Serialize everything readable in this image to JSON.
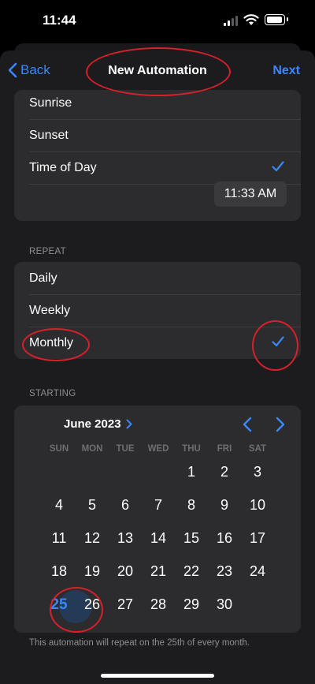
{
  "status_bar": {
    "time": "11:44"
  },
  "nav": {
    "back_label": "Back",
    "title": "New Automation",
    "next_label": "Next"
  },
  "time_options": {
    "items": [
      {
        "label": "Sunrise",
        "selected": false
      },
      {
        "label": "Sunset",
        "selected": false
      },
      {
        "label": "Time of Day",
        "selected": true
      }
    ],
    "time_value": "11:33 AM"
  },
  "repeat": {
    "header": "REPEAT",
    "items": [
      {
        "label": "Daily",
        "selected": false
      },
      {
        "label": "Weekly",
        "selected": false
      },
      {
        "label": "Monthly",
        "selected": true
      }
    ]
  },
  "starting": {
    "header": "STARTING",
    "month_label": "June 2023",
    "weekdays": [
      "SUN",
      "MON",
      "TUE",
      "WED",
      "THU",
      "FRI",
      "SAT"
    ],
    "first_weekday_index": 4,
    "days_in_month": 30,
    "selected_day": 25
  },
  "footnote": "This automation will repeat on the 25th of every month.",
  "colors": {
    "accent": "#3a88f7",
    "background": "#000000",
    "card": "#2c2c2e",
    "annotation": "#d9202a"
  }
}
